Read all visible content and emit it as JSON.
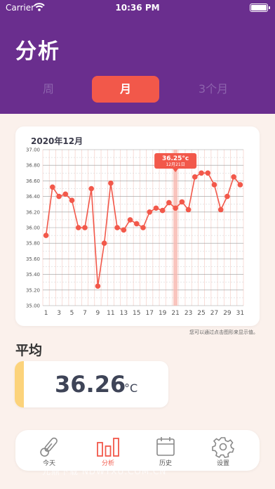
{
  "status_bar": {
    "carrier": "Carrier",
    "time": "10:36 PM"
  },
  "header": {
    "title": "分析"
  },
  "tabs": [
    {
      "label": "周",
      "selected": false
    },
    {
      "label": "月",
      "selected": true
    },
    {
      "label": "3个月",
      "selected": false
    }
  ],
  "chart_card": {
    "title": "2020年12月",
    "hint": "您可以通过点击图形来显示值。",
    "tooltip": {
      "value": "36.25°c",
      "date": "12月21日"
    }
  },
  "chart_data": {
    "type": "line",
    "title": "2020年12月",
    "x": [
      1,
      2,
      3,
      4,
      5,
      6,
      7,
      8,
      9,
      10,
      11,
      12,
      13,
      14,
      15,
      16,
      17,
      18,
      19,
      20,
      21,
      22,
      23,
      24,
      25,
      26,
      27,
      28,
      29,
      30,
      31
    ],
    "x_tick_labels": [
      "1",
      "3",
      "5",
      "7",
      "9",
      "11",
      "13",
      "15",
      "17",
      "19",
      "21",
      "23",
      "25",
      "27",
      "29",
      "31"
    ],
    "y_tick_labels": [
      "37.00",
      "36.80",
      "36.60",
      "36.40",
      "36.20",
      "36.00",
      "35.80",
      "35.60",
      "35.40",
      "35.20",
      "35.00"
    ],
    "ylim": [
      35.0,
      37.0
    ],
    "series": [
      {
        "values": [
          35.9,
          36.52,
          36.4,
          36.43,
          36.35,
          36.0,
          36.0,
          36.5,
          35.25,
          35.8,
          36.57,
          36.0,
          35.97,
          36.1,
          36.05,
          36.0,
          36.2,
          36.25,
          36.22,
          36.32,
          36.25,
          36.33,
          36.23,
          36.65,
          36.7,
          36.7,
          36.55,
          36.23,
          36.4,
          36.65,
          36.55
        ]
      }
    ],
    "highlighted_x": 21,
    "grid": true,
    "line_color": "#f2584a",
    "highlight_color": "#f7b7ae"
  },
  "average": {
    "title": "平均",
    "value": "36.26",
    "unit": "°C"
  },
  "bottom_nav": [
    {
      "label": "今天",
      "icon": "thermometer-icon",
      "active": false
    },
    {
      "label": "分析",
      "icon": "bar-chart-icon",
      "active": true
    },
    {
      "label": "历史",
      "icon": "calendar-icon",
      "active": false
    },
    {
      "label": "设置",
      "icon": "gear-icon",
      "active": false
    }
  ],
  "watermark": "元鼎下载 NDWYXU.COM.CN",
  "colors": {
    "header_bg": "#6a2e8e",
    "accent": "#f2584a",
    "page_bg": "#fbf1ec",
    "average_accent": "#fcd37b"
  }
}
